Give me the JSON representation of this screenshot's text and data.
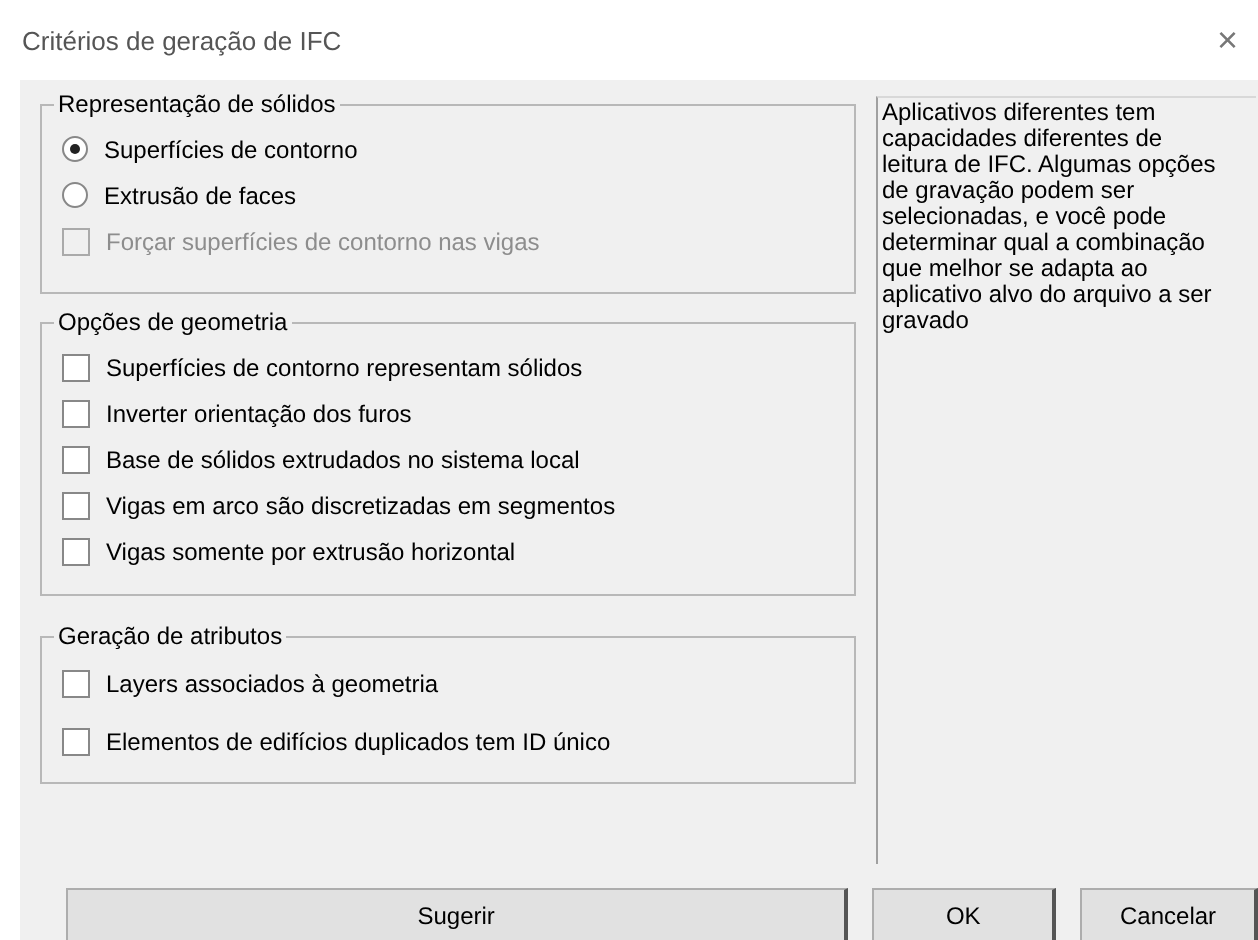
{
  "window": {
    "title": "Critérios de geração de IFC",
    "close": "×"
  },
  "sections": [
    {
      "title": "Representação de sólidos",
      "items": [
        {
          "kind": "radio",
          "label": "Superfícies de contorno",
          "selected": true,
          "disabled": false
        },
        {
          "kind": "radio",
          "label": "Extrusão de faces",
          "selected": false,
          "disabled": false
        },
        {
          "kind": "checkbox",
          "label": "Forçar superfícies de contorno nas vigas",
          "checked": false,
          "disabled": true
        }
      ]
    },
    {
      "title": "Opções de geometria",
      "items": [
        {
          "kind": "checkbox",
          "label": "Superfícies de contorno representam sólidos",
          "checked": false,
          "disabled": false
        },
        {
          "kind": "checkbox",
          "label": "Inverter orientação dos furos",
          "checked": false,
          "disabled": false
        },
        {
          "kind": "checkbox",
          "label": "Base de sólidos extrudados no sistema local",
          "checked": false,
          "disabled": false
        },
        {
          "kind": "checkbox",
          "label": "Vigas em arco são discretizadas em segmentos",
          "checked": false,
          "disabled": false
        },
        {
          "kind": "checkbox",
          "label": "Vigas somente por extrusão horizontal",
          "checked": false,
          "disabled": false
        }
      ]
    },
    {
      "title": "Geração de atributos",
      "items": [
        {
          "kind": "checkbox",
          "label": "Layers associados à geometria",
          "checked": false,
          "disabled": false
        },
        {
          "kind": "checkbox",
          "label": "Elementos de edifícios duplicados tem ID único",
          "checked": false,
          "disabled": false
        }
      ]
    }
  ],
  "help_text": "Aplicativos diferentes tem capacidades diferentes de leitura de IFC. Algumas opções de gravação podem ser selecionadas, e você pode determinar qual a combinação que melhor se adapta ao aplicativo alvo do arquivo a ser gravado",
  "buttons": [
    "Sugerir",
    "OK",
    "Cancelar"
  ]
}
